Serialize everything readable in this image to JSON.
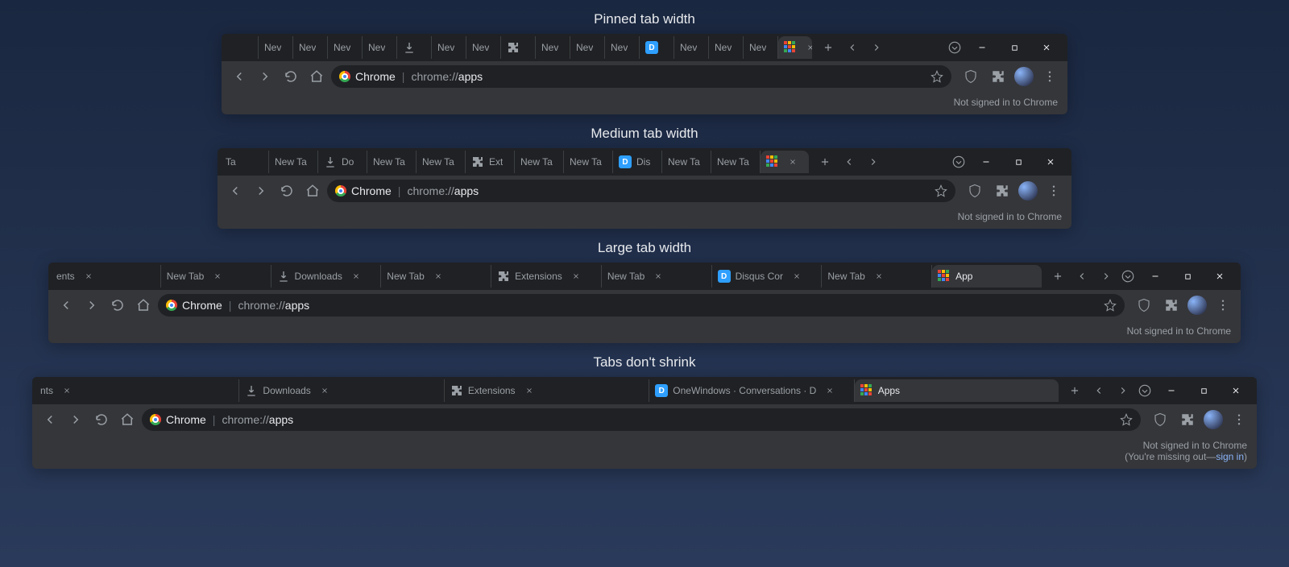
{
  "labels": {
    "pinned": "Pinned tab width",
    "medium": "Medium tab width",
    "large": "Large tab width",
    "noshrink": "Tabs don't shrink"
  },
  "common": {
    "chipName": "Chrome",
    "urlPrefix": "chrome://",
    "urlPath": "apps",
    "notSigned": "Not signed in to Chrome",
    "missing": "(You're missing out—",
    "signin": "sign in",
    "missingEnd": ")"
  },
  "w1": {
    "tabs": [
      {
        "title": "",
        "icon": "none",
        "partial": true
      },
      {
        "title": "Nev",
        "icon": "none"
      },
      {
        "title": "Nev",
        "icon": "none"
      },
      {
        "title": "Nev",
        "icon": "none"
      },
      {
        "title": "Nev",
        "icon": "none"
      },
      {
        "title": "",
        "icon": "download"
      },
      {
        "title": "Nev",
        "icon": "none"
      },
      {
        "title": "Nev",
        "icon": "none"
      },
      {
        "title": "",
        "icon": "puzzle"
      },
      {
        "title": "Nev",
        "icon": "none"
      },
      {
        "title": "Nev",
        "icon": "none"
      },
      {
        "title": "Nev",
        "icon": "none"
      },
      {
        "title": "",
        "icon": "disqus"
      },
      {
        "title": "Nev",
        "icon": "none"
      },
      {
        "title": "Nev",
        "icon": "none"
      },
      {
        "title": "Nev",
        "icon": "none"
      },
      {
        "title": "",
        "icon": "apps",
        "active": true,
        "close": true
      }
    ]
  },
  "w2": {
    "tabs": [
      {
        "title": "Ta",
        "icon": "none",
        "partial": true
      },
      {
        "title": "New Ta",
        "icon": "none"
      },
      {
        "title": "Do",
        "icon": "download"
      },
      {
        "title": "New Ta",
        "icon": "none"
      },
      {
        "title": "New Ta",
        "icon": "none"
      },
      {
        "title": "Ext",
        "icon": "puzzle"
      },
      {
        "title": "New Ta",
        "icon": "none"
      },
      {
        "title": "New Ta",
        "icon": "none"
      },
      {
        "title": "Dis",
        "icon": "disqus"
      },
      {
        "title": "New Ta",
        "icon": "none"
      },
      {
        "title": "New Ta",
        "icon": "none"
      },
      {
        "title": "",
        "icon": "apps",
        "active": true,
        "close": true
      }
    ]
  },
  "w3": {
    "tabs": [
      {
        "title": "ents",
        "icon": "none",
        "partial": true,
        "close": true
      },
      {
        "title": "New Tab",
        "icon": "none",
        "close": true
      },
      {
        "title": "Downloads",
        "icon": "download",
        "close": true
      },
      {
        "title": "New Tab",
        "icon": "none",
        "close": true
      },
      {
        "title": "Extensions",
        "icon": "puzzle",
        "close": true
      },
      {
        "title": "New Tab",
        "icon": "none",
        "close": true
      },
      {
        "title": "Disqus Cor",
        "icon": "disqus",
        "close": true
      },
      {
        "title": "New Tab",
        "icon": "none",
        "close": true
      },
      {
        "title": "App",
        "icon": "apps",
        "active": true
      }
    ]
  },
  "w4": {
    "tabs": [
      {
        "title": "nts",
        "icon": "none",
        "partial": true,
        "close": true
      },
      {
        "title": "Downloads",
        "icon": "download",
        "close": true
      },
      {
        "title": "Extensions",
        "icon": "puzzle",
        "close": true
      },
      {
        "title": "OneWindows · Conversations · D",
        "icon": "disqus",
        "close": true
      },
      {
        "title": "Apps",
        "icon": "apps",
        "active": true
      }
    ]
  }
}
